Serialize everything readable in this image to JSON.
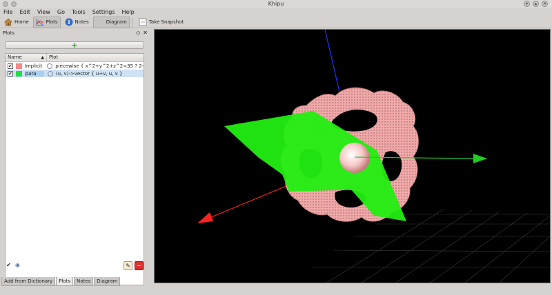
{
  "window": {
    "title": "Khipu"
  },
  "menu": [
    "File",
    "Edit",
    "View",
    "Go",
    "Tools",
    "Settings",
    "Help"
  ],
  "toolbar": {
    "home": "Home",
    "plots": "Plots",
    "notes": "Notes",
    "diagram": "Diagram",
    "snapshot": "Take Snapshot"
  },
  "dock": {
    "title": "Plots"
  },
  "list": {
    "headers": {
      "name": "Name",
      "plot": "Plot"
    },
    "rows": [
      {
        "name": "Implicit",
        "color": "#f28a8a",
        "expr": "piecewise { x^2+y^2+z^2<35 ? 2-(co..."
      },
      {
        "name": "para",
        "color": "#22dd44",
        "expr": "(u, v)->vector { u+v, u, v }"
      }
    ]
  },
  "tabs": [
    "Add from Dictionary",
    "Plots",
    "Notes",
    "Diagram"
  ],
  "colors": {
    "surface": "#f0a8a8",
    "plane": "#22ee11",
    "axis_x": "#ff2020",
    "axis_y": "#22cc22",
    "axis_z": "#2233ff"
  }
}
